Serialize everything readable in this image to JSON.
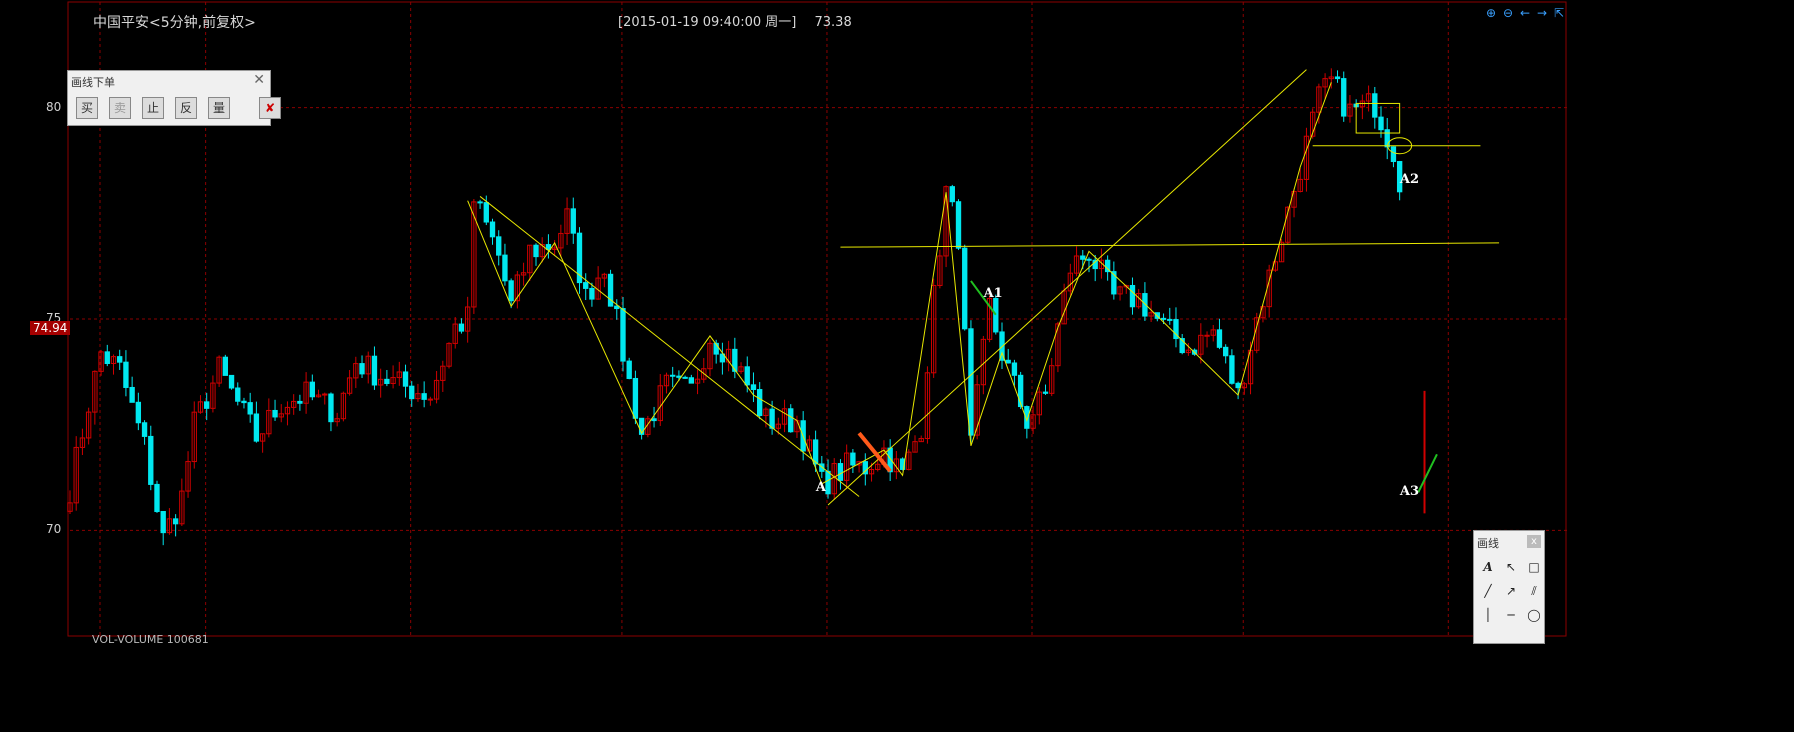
{
  "header": {
    "title": "中国平安<5分钟,前复权>",
    "datetime": "[2015-01-19  09:40:00 周一]",
    "price": "73.38"
  },
  "current_price_label": "74.94",
  "bottom_text": "VOL-VOLUME  100681",
  "order_panel": {
    "title": "画线下单",
    "buttons": [
      "买",
      "卖",
      "止",
      "反",
      "量"
    ],
    "delete_icon": "delete-icon"
  },
  "draw_tools": {
    "title": "画线",
    "close": "x",
    "icons": [
      "text-icon",
      "arrow-icon",
      "rectangle-icon",
      "line-icon",
      "ray-icon",
      "parallel-lines-icon",
      "vertical-line-icon",
      "horizontal-line-icon",
      "ellipse-icon",
      "fib-icon",
      "channel-icon",
      "trend-icon"
    ]
  },
  "top_tools": [
    "zoom-in-icon",
    "zoom-out-icon",
    "pan-left-icon",
    "pan-right-icon",
    "restore-icon"
  ],
  "annotations": [
    {
      "id": "A",
      "x": 121,
      "y": 71.0
    },
    {
      "id": "A1",
      "x": 148,
      "y": 75.6
    },
    {
      "id": "A2",
      "x": 215,
      "y": 78.3
    },
    {
      "id": "A3",
      "x": 215,
      "y": 70.9
    }
  ],
  "colors": {
    "bg": "#000000",
    "up": "#d00000",
    "down": "#00e8f0",
    "drawing": "#e8e800",
    "grid": "#8b0000",
    "arrow_orange": "#ff5a1a",
    "arrow_green": "#20c020"
  },
  "chart_data": {
    "type": "candlestick",
    "title": "中国平安<5分钟,前复权>",
    "ylim": [
      67.5,
      82.5
    ],
    "yticks": [
      70,
      75,
      80
    ],
    "xlim": [
      0,
      225
    ],
    "grid": true,
    "anchors": [
      [
        0,
        71
      ],
      [
        3,
        73
      ],
      [
        5,
        74.2
      ],
      [
        8,
        73.8
      ],
      [
        12,
        72.0
      ],
      [
        15,
        69.8
      ],
      [
        18,
        70.8
      ],
      [
        20,
        72.5
      ],
      [
        24,
        73.8
      ],
      [
        30,
        72.2
      ],
      [
        34,
        73.0
      ],
      [
        38,
        73.2
      ],
      [
        43,
        72.8
      ],
      [
        46,
        74.0
      ],
      [
        52,
        73.5
      ],
      [
        58,
        73.2
      ],
      [
        62,
        74.8
      ],
      [
        64,
        75.0
      ],
      [
        65,
        77.8
      ],
      [
        67,
        77.2
      ],
      [
        69,
        76.5
      ],
      [
        71,
        75.3
      ],
      [
        74,
        76.6
      ],
      [
        78,
        76.8
      ],
      [
        80,
        77.4
      ],
      [
        83,
        75.5
      ],
      [
        86,
        76.3
      ],
      [
        90,
        73.5
      ],
      [
        92,
        72.3
      ],
      [
        96,
        73.4
      ],
      [
        100,
        73.3
      ],
      [
        103,
        74.6
      ],
      [
        106,
        74.2
      ],
      [
        110,
        73.2
      ],
      [
        112,
        72.6
      ],
      [
        117,
        72.6
      ],
      [
        121,
        71.1
      ],
      [
        125,
        71.5
      ],
      [
        128,
        71.5
      ],
      [
        131,
        71.9
      ],
      [
        134,
        71.3
      ],
      [
        137,
        72.5
      ],
      [
        139,
        75.5
      ],
      [
        141,
        78.0
      ],
      [
        143,
        77.0
      ],
      [
        145,
        72.0
      ],
      [
        148,
        75.3
      ],
      [
        150,
        74.2
      ],
      [
        154,
        72.6
      ],
      [
        157,
        73.2
      ],
      [
        159,
        74.8
      ],
      [
        161,
        76.2
      ],
      [
        164,
        76.6
      ],
      [
        168,
        75.5
      ],
      [
        172,
        75.5
      ],
      [
        176,
        74.8
      ],
      [
        180,
        74.3
      ],
      [
        184,
        74.7
      ],
      [
        188,
        73.2
      ],
      [
        191,
        75.0
      ],
      [
        195,
        77.0
      ],
      [
        198,
        78.6
      ],
      [
        201,
        80.2
      ],
      [
        203,
        80.6
      ],
      [
        206,
        79.9
      ],
      [
        210,
        80.1
      ],
      [
        213,
        79.0
      ],
      [
        214,
        78.3
      ]
    ],
    "a3_bar": {
      "x": 218,
      "open": 70.4,
      "close": 73.3
    }
  }
}
